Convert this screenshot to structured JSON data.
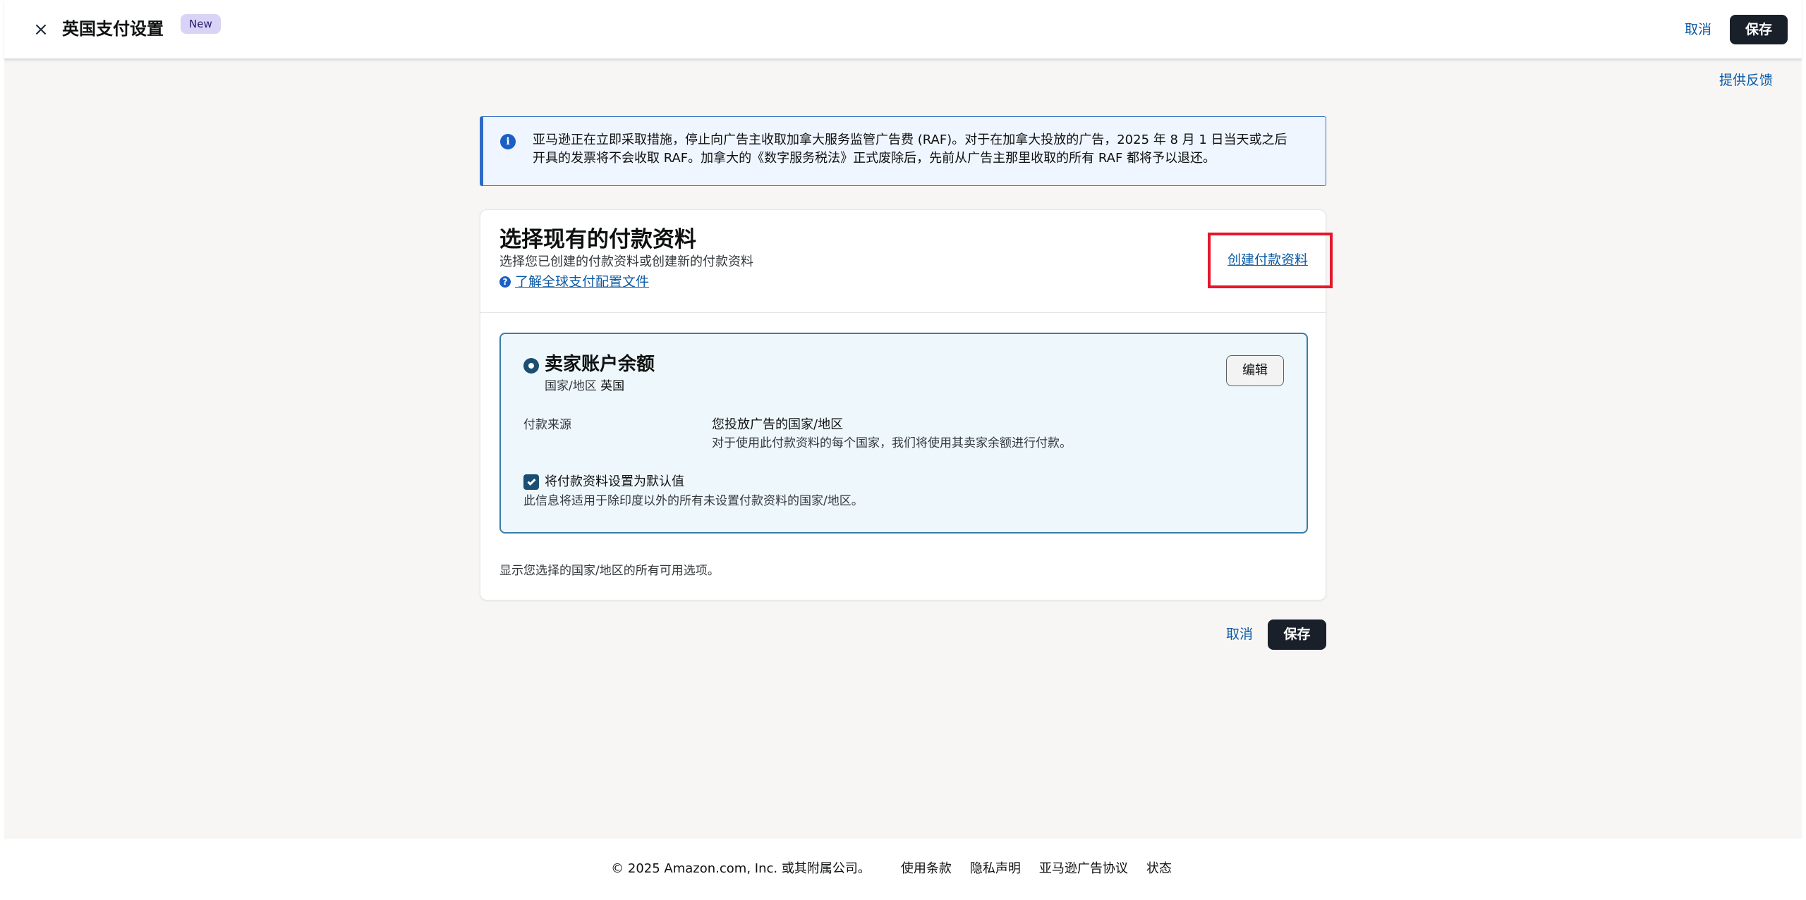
{
  "header": {
    "title": "英国支付设置",
    "badge": "New",
    "cancel_label": "取消",
    "save_label": "保存",
    "close_icon": "×"
  },
  "feedback_label": "提供反馈",
  "info_alert": {
    "icon": "i",
    "text_line1": "亚马逊正在立即采取措施，停止向广告主收取加拿大服务监管广告费 (RAF)。对于在加拿大投放的广告，2025 年 8 月 1 日当天或之后",
    "text_line2": "开具的发票将不会收取 RAF。加拿大的《数字服务税法》正式废除后，先前从广告主那里收取的所有 RAF 都将予以退还。"
  },
  "payment_card": {
    "title": "选择现有的付款资料",
    "subtitle": "选择您已创建的付款资料或创建新的付款资料",
    "help_icon": "?",
    "learn_link": "了解全球支付配置文件",
    "create_link": "创建付款资料",
    "option": {
      "title": "卖家账户余额",
      "country_label": "国家/地区",
      "country_value": "英国",
      "edit_label": "编辑",
      "source_label": "付款来源",
      "source_value": "您投放广告的国家/地区",
      "source_desc": "对于使用此付款资料的每个国家，我们将使用其卖家余额进行付款。",
      "selected": true,
      "default_checked": true,
      "default_label": "将付款资料设置为默认值",
      "default_desc": "此信息将适用于除印度以外的所有未设置付款资料的国家/地区。"
    },
    "footer_text": "显示您选择的国家/地区的所有可用选项。"
  },
  "actions": {
    "cancel_label": "取消",
    "save_label": "保存"
  },
  "footer": {
    "copyright": "© 2025 Amazon.com, Inc. 或其附属公司。",
    "links": [
      "使用条款",
      "隐私声明",
      "亚马逊广告协议",
      "状态"
    ]
  },
  "colors": {
    "accent_link": "#0a5aa6",
    "primary_button": "#1a202a",
    "highlight_box": "#e4172b",
    "option_bg": "#eef7fc",
    "alert_bg": "#f0f6ff"
  }
}
